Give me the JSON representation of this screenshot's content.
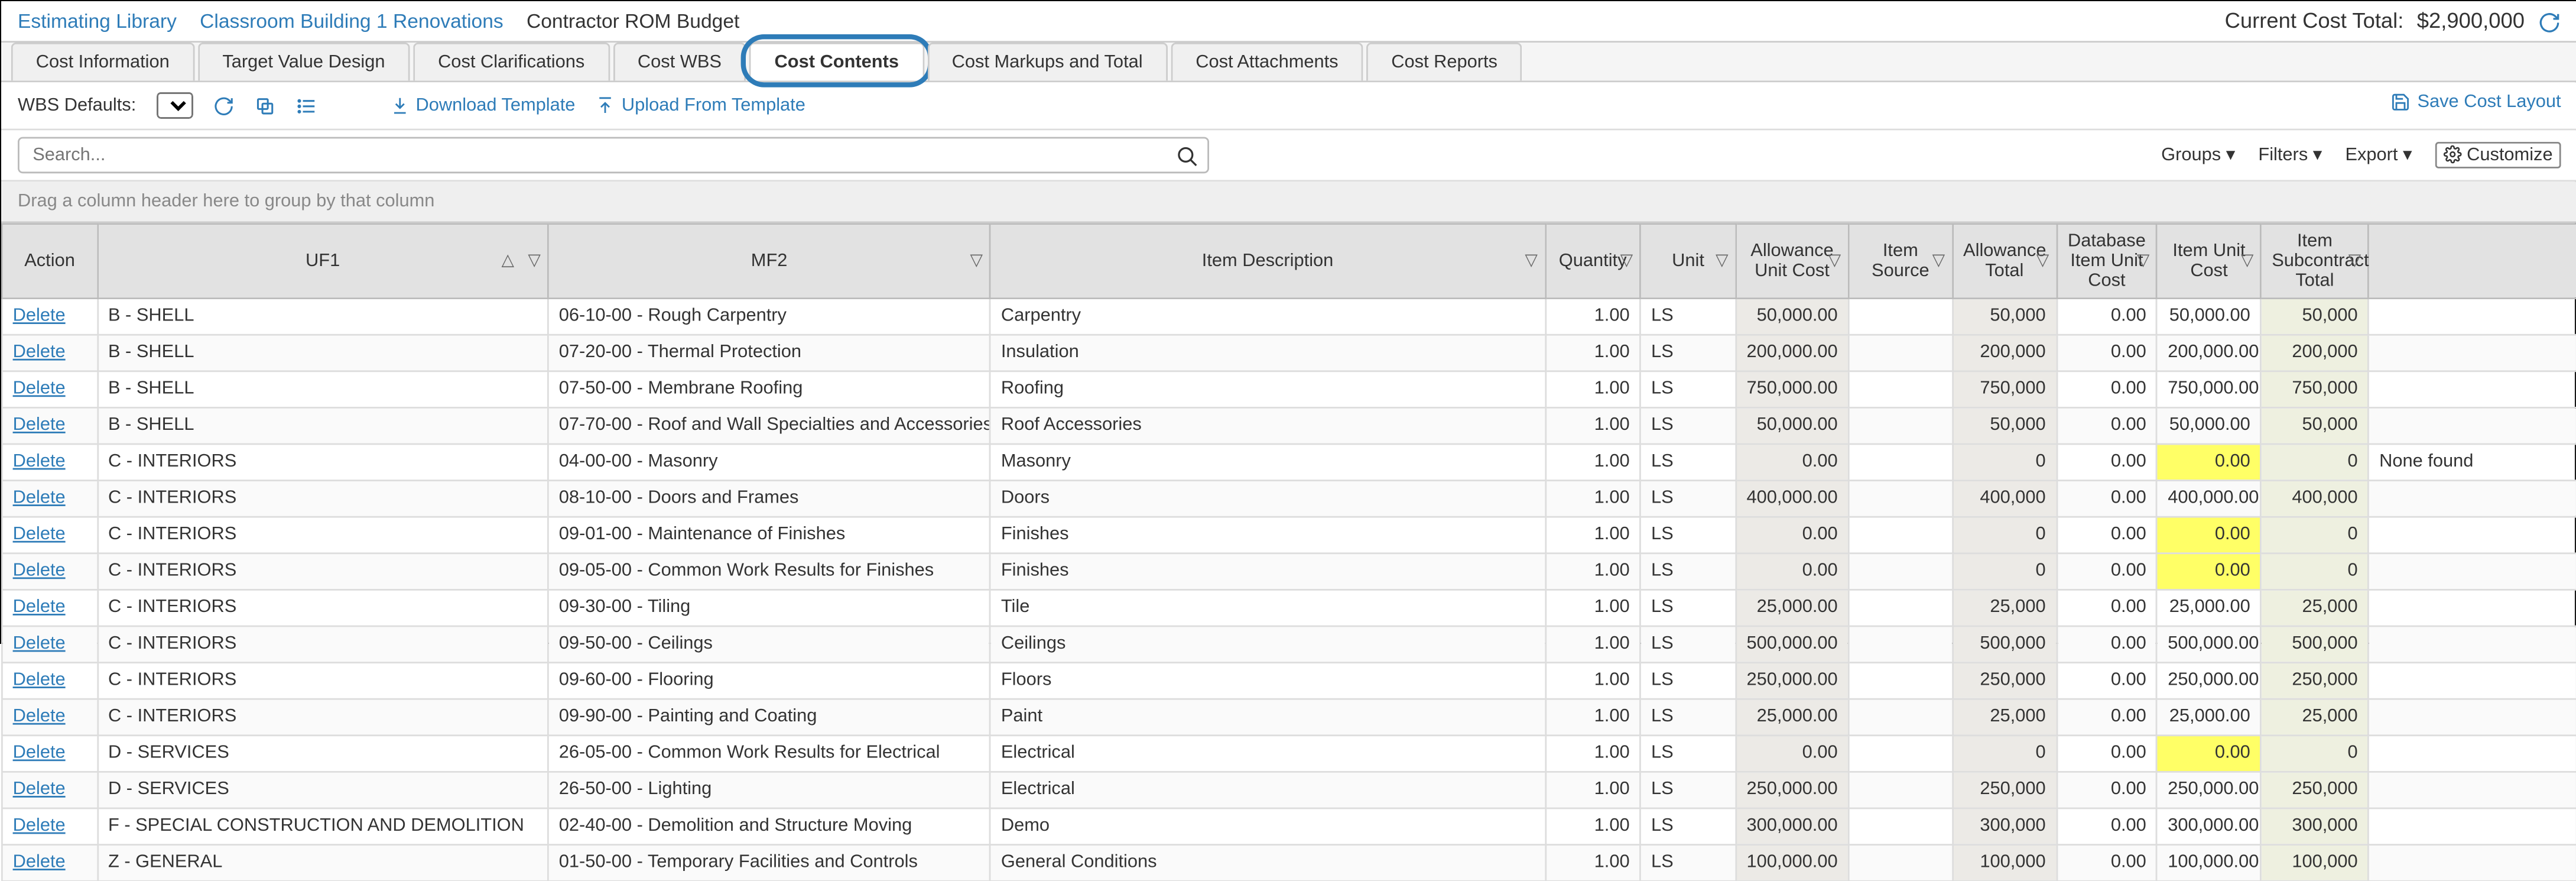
{
  "breadcrumb": {
    "lib": "Estimating Library",
    "project": "Classroom Building 1 Renovations",
    "current": "Contractor ROM Budget"
  },
  "cost_total_label": "Current Cost Total:",
  "cost_total_value": "$2,900,000",
  "tabs": [
    "Cost Information",
    "Target Value Design",
    "Cost Clarifications",
    "Cost WBS",
    "Cost Contents",
    "Cost Markups and Total",
    "Cost Attachments",
    "Cost Reports"
  ],
  "active_tab": 4,
  "toolbar": {
    "wbs_label": "WBS Defaults:",
    "download": "Download Template",
    "upload": "Upload From Template",
    "save_layout": "Save Cost Layout"
  },
  "search_placeholder": "Search...",
  "right_controls": {
    "groups": "Groups",
    "filters": "Filters",
    "export": "Export",
    "customize": "Customize"
  },
  "group_hint": "Drag a column header here to group by that column",
  "columns": {
    "action": "Action",
    "uf1": "UF1",
    "mf2": "MF2",
    "desc": "Item Description",
    "qty": "Quantity",
    "unit": "Unit",
    "allow_uc": "Allowance Unit Cost",
    "src": "Item Source",
    "allow_tot": "Allowance Total",
    "db_iuc": "Database Item Unit Cost",
    "iuc": "Item Unit Cost",
    "sub_tot": "Item Subcontractor Total"
  },
  "delete_label": "Delete",
  "rows": [
    {
      "uf1": "B - SHELL",
      "mf2": "06-10-00 - Rough Carpentry",
      "desc": "Carpentry",
      "qty": "1.00",
      "unit": "LS",
      "allow_uc": "50,000.00",
      "src": "",
      "allow_tot": "50,000",
      "db_iuc": "0.00",
      "iuc": "50,000.00",
      "sub_tot": "50,000",
      "note": ""
    },
    {
      "uf1": "B - SHELL",
      "mf2": "07-20-00 - Thermal Protection",
      "desc": "Insulation",
      "qty": "1.00",
      "unit": "LS",
      "allow_uc": "200,000.00",
      "src": "",
      "allow_tot": "200,000",
      "db_iuc": "0.00",
      "iuc": "200,000.00",
      "sub_tot": "200,000",
      "note": ""
    },
    {
      "uf1": "B - SHELL",
      "mf2": "07-50-00 - Membrane Roofing",
      "desc": "Roofing",
      "qty": "1.00",
      "unit": "LS",
      "allow_uc": "750,000.00",
      "src": "",
      "allow_tot": "750,000",
      "db_iuc": "0.00",
      "iuc": "750,000.00",
      "sub_tot": "750,000",
      "note": ""
    },
    {
      "uf1": "B - SHELL",
      "mf2": "07-70-00 - Roof and Wall Specialties and Accessories",
      "desc": "Roof Accessories",
      "qty": "1.00",
      "unit": "LS",
      "allow_uc": "50,000.00",
      "src": "",
      "allow_tot": "50,000",
      "db_iuc": "0.00",
      "iuc": "50,000.00",
      "sub_tot": "50,000",
      "note": ""
    },
    {
      "uf1": "C - INTERIORS",
      "mf2": "04-00-00 - Masonry",
      "desc": "Masonry",
      "qty": "1.00",
      "unit": "LS",
      "allow_uc": "0.00",
      "src": "",
      "allow_tot": "0",
      "db_iuc": "0.00",
      "iuc": "0.00",
      "iuc_hl": true,
      "sub_tot": "0",
      "note": "None found"
    },
    {
      "uf1": "C - INTERIORS",
      "mf2": "08-10-00 - Doors and Frames",
      "desc": "Doors",
      "qty": "1.00",
      "unit": "LS",
      "allow_uc": "400,000.00",
      "src": "",
      "allow_tot": "400,000",
      "db_iuc": "0.00",
      "iuc": "400,000.00",
      "sub_tot": "400,000",
      "note": ""
    },
    {
      "uf1": "C - INTERIORS",
      "mf2": "09-01-00 - Maintenance of Finishes",
      "desc": "Finishes",
      "qty": "1.00",
      "unit": "LS",
      "allow_uc": "0.00",
      "src": "",
      "allow_tot": "0",
      "db_iuc": "0.00",
      "iuc": "0.00",
      "iuc_hl": true,
      "sub_tot": "0",
      "note": ""
    },
    {
      "uf1": "C - INTERIORS",
      "mf2": "09-05-00 - Common Work Results for Finishes",
      "desc": "Finishes",
      "qty": "1.00",
      "unit": "LS",
      "allow_uc": "0.00",
      "src": "",
      "allow_tot": "0",
      "db_iuc": "0.00",
      "iuc": "0.00",
      "iuc_hl": true,
      "sub_tot": "0",
      "note": ""
    },
    {
      "uf1": "C - INTERIORS",
      "mf2": "09-30-00 - Tiling",
      "desc": "Tile",
      "qty": "1.00",
      "unit": "LS",
      "allow_uc": "25,000.00",
      "src": "",
      "allow_tot": "25,000",
      "db_iuc": "0.00",
      "iuc": "25,000.00",
      "sub_tot": "25,000",
      "note": ""
    },
    {
      "uf1": "C - INTERIORS",
      "mf2": "09-50-00 - Ceilings",
      "desc": "Ceilings",
      "qty": "1.00",
      "unit": "LS",
      "allow_uc": "500,000.00",
      "src": "",
      "allow_tot": "500,000",
      "db_iuc": "0.00",
      "iuc": "500,000.00",
      "sub_tot": "500,000",
      "note": ""
    },
    {
      "uf1": "C - INTERIORS",
      "mf2": "09-60-00 - Flooring",
      "desc": "Floors",
      "qty": "1.00",
      "unit": "LS",
      "allow_uc": "250,000.00",
      "src": "",
      "allow_tot": "250,000",
      "db_iuc": "0.00",
      "iuc": "250,000.00",
      "sub_tot": "250,000",
      "note": ""
    },
    {
      "uf1": "C - INTERIORS",
      "mf2": "09-90-00 - Painting and Coating",
      "desc": "Paint",
      "qty": "1.00",
      "unit": "LS",
      "allow_uc": "25,000.00",
      "src": "",
      "allow_tot": "25,000",
      "db_iuc": "0.00",
      "iuc": "25,000.00",
      "sub_tot": "25,000",
      "note": ""
    },
    {
      "uf1": "D - SERVICES",
      "mf2": "26-05-00 - Common Work Results for Electrical",
      "desc": "Electrical",
      "qty": "1.00",
      "unit": "LS",
      "allow_uc": "0.00",
      "src": "",
      "allow_tot": "0",
      "db_iuc": "0.00",
      "iuc": "0.00",
      "iuc_hl": true,
      "sub_tot": "0",
      "note": ""
    },
    {
      "uf1": "D - SERVICES",
      "mf2": "26-50-00 - Lighting",
      "desc": "Electrical",
      "qty": "1.00",
      "unit": "LS",
      "allow_uc": "250,000.00",
      "src": "",
      "allow_tot": "250,000",
      "db_iuc": "0.00",
      "iuc": "250,000.00",
      "sub_tot": "250,000",
      "note": ""
    },
    {
      "uf1": "F - SPECIAL CONSTRUCTION AND DEMOLITION",
      "mf2": "02-40-00 - Demolition and Structure Moving",
      "desc": "Demo",
      "qty": "1.00",
      "unit": "LS",
      "allow_uc": "300,000.00",
      "src": "",
      "allow_tot": "300,000",
      "db_iuc": "0.00",
      "iuc": "300,000.00",
      "sub_tot": "300,000",
      "note": ""
    },
    {
      "uf1": "Z - GENERAL",
      "mf2": "01-50-00 - Temporary Facilities and Controls",
      "desc": "General Conditions",
      "qty": "1.00",
      "unit": "LS",
      "allow_uc": "100,000.00",
      "src": "",
      "allow_tot": "100,000",
      "db_iuc": "0.00",
      "iuc": "100,000.00",
      "sub_tot": "100,000",
      "note": ""
    }
  ]
}
